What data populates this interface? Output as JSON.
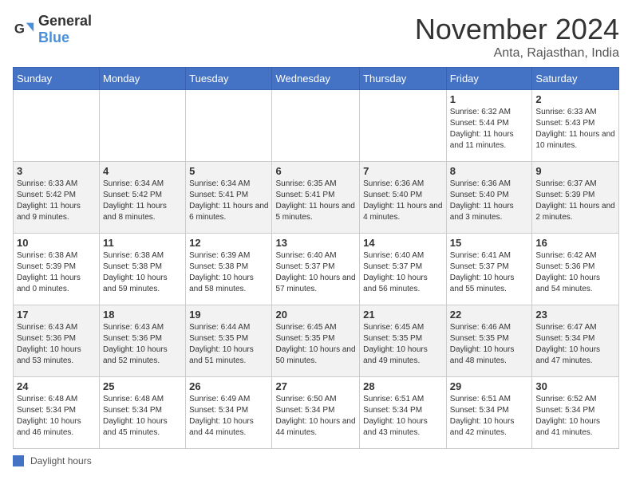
{
  "logo": {
    "general": "General",
    "blue": "Blue"
  },
  "title": "November 2024",
  "subtitle": "Anta, Rajasthan, India",
  "days_of_week": [
    "Sunday",
    "Monday",
    "Tuesday",
    "Wednesday",
    "Thursday",
    "Friday",
    "Saturday"
  ],
  "weeks": [
    [
      {
        "day": "",
        "info": ""
      },
      {
        "day": "",
        "info": ""
      },
      {
        "day": "",
        "info": ""
      },
      {
        "day": "",
        "info": ""
      },
      {
        "day": "",
        "info": ""
      },
      {
        "day": "1",
        "info": "Sunrise: 6:32 AM\nSunset: 5:44 PM\nDaylight: 11 hours and 11 minutes."
      },
      {
        "day": "2",
        "info": "Sunrise: 6:33 AM\nSunset: 5:43 PM\nDaylight: 11 hours and 10 minutes."
      }
    ],
    [
      {
        "day": "3",
        "info": "Sunrise: 6:33 AM\nSunset: 5:42 PM\nDaylight: 11 hours and 9 minutes."
      },
      {
        "day": "4",
        "info": "Sunrise: 6:34 AM\nSunset: 5:42 PM\nDaylight: 11 hours and 8 minutes."
      },
      {
        "day": "5",
        "info": "Sunrise: 6:34 AM\nSunset: 5:41 PM\nDaylight: 11 hours and 6 minutes."
      },
      {
        "day": "6",
        "info": "Sunrise: 6:35 AM\nSunset: 5:41 PM\nDaylight: 11 hours and 5 minutes."
      },
      {
        "day": "7",
        "info": "Sunrise: 6:36 AM\nSunset: 5:40 PM\nDaylight: 11 hours and 4 minutes."
      },
      {
        "day": "8",
        "info": "Sunrise: 6:36 AM\nSunset: 5:40 PM\nDaylight: 11 hours and 3 minutes."
      },
      {
        "day": "9",
        "info": "Sunrise: 6:37 AM\nSunset: 5:39 PM\nDaylight: 11 hours and 2 minutes."
      }
    ],
    [
      {
        "day": "10",
        "info": "Sunrise: 6:38 AM\nSunset: 5:39 PM\nDaylight: 11 hours and 0 minutes."
      },
      {
        "day": "11",
        "info": "Sunrise: 6:38 AM\nSunset: 5:38 PM\nDaylight: 10 hours and 59 minutes."
      },
      {
        "day": "12",
        "info": "Sunrise: 6:39 AM\nSunset: 5:38 PM\nDaylight: 10 hours and 58 minutes."
      },
      {
        "day": "13",
        "info": "Sunrise: 6:40 AM\nSunset: 5:37 PM\nDaylight: 10 hours and 57 minutes."
      },
      {
        "day": "14",
        "info": "Sunrise: 6:40 AM\nSunset: 5:37 PM\nDaylight: 10 hours and 56 minutes."
      },
      {
        "day": "15",
        "info": "Sunrise: 6:41 AM\nSunset: 5:37 PM\nDaylight: 10 hours and 55 minutes."
      },
      {
        "day": "16",
        "info": "Sunrise: 6:42 AM\nSunset: 5:36 PM\nDaylight: 10 hours and 54 minutes."
      }
    ],
    [
      {
        "day": "17",
        "info": "Sunrise: 6:43 AM\nSunset: 5:36 PM\nDaylight: 10 hours and 53 minutes."
      },
      {
        "day": "18",
        "info": "Sunrise: 6:43 AM\nSunset: 5:36 PM\nDaylight: 10 hours and 52 minutes."
      },
      {
        "day": "19",
        "info": "Sunrise: 6:44 AM\nSunset: 5:35 PM\nDaylight: 10 hours and 51 minutes."
      },
      {
        "day": "20",
        "info": "Sunrise: 6:45 AM\nSunset: 5:35 PM\nDaylight: 10 hours and 50 minutes."
      },
      {
        "day": "21",
        "info": "Sunrise: 6:45 AM\nSunset: 5:35 PM\nDaylight: 10 hours and 49 minutes."
      },
      {
        "day": "22",
        "info": "Sunrise: 6:46 AM\nSunset: 5:35 PM\nDaylight: 10 hours and 48 minutes."
      },
      {
        "day": "23",
        "info": "Sunrise: 6:47 AM\nSunset: 5:34 PM\nDaylight: 10 hours and 47 minutes."
      }
    ],
    [
      {
        "day": "24",
        "info": "Sunrise: 6:48 AM\nSunset: 5:34 PM\nDaylight: 10 hours and 46 minutes."
      },
      {
        "day": "25",
        "info": "Sunrise: 6:48 AM\nSunset: 5:34 PM\nDaylight: 10 hours and 45 minutes."
      },
      {
        "day": "26",
        "info": "Sunrise: 6:49 AM\nSunset: 5:34 PM\nDaylight: 10 hours and 44 minutes."
      },
      {
        "day": "27",
        "info": "Sunrise: 6:50 AM\nSunset: 5:34 PM\nDaylight: 10 hours and 44 minutes."
      },
      {
        "day": "28",
        "info": "Sunrise: 6:51 AM\nSunset: 5:34 PM\nDaylight: 10 hours and 43 minutes."
      },
      {
        "day": "29",
        "info": "Sunrise: 6:51 AM\nSunset: 5:34 PM\nDaylight: 10 hours and 42 minutes."
      },
      {
        "day": "30",
        "info": "Sunrise: 6:52 AM\nSunset: 5:34 PM\nDaylight: 10 hours and 41 minutes."
      }
    ]
  ],
  "legend": {
    "color_label": "Daylight hours"
  }
}
